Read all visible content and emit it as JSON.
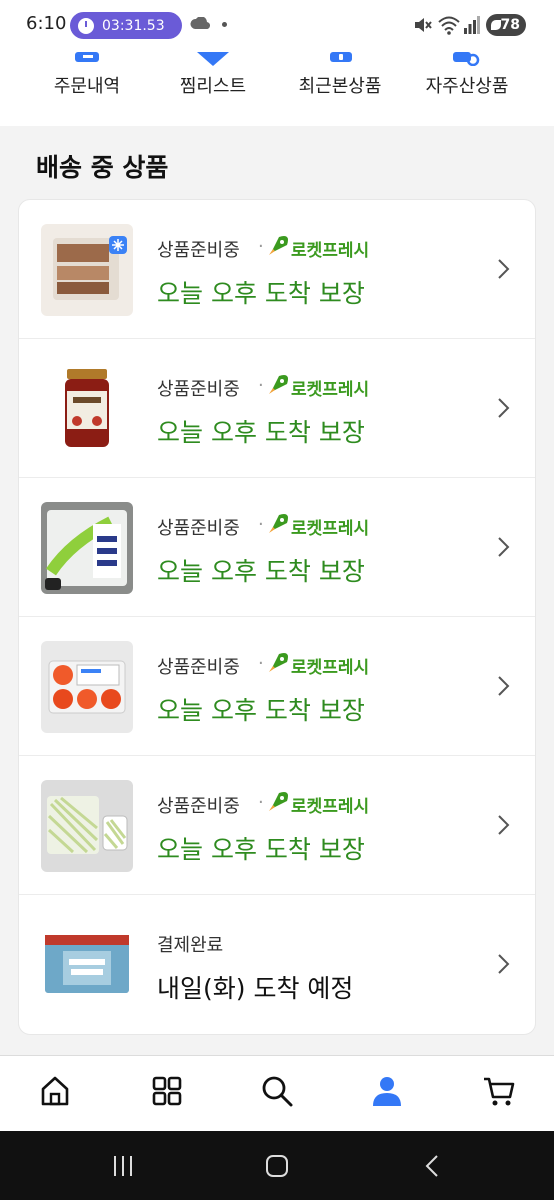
{
  "status_bar": {
    "time": "6:10",
    "timer": "03:31.53",
    "battery": "78"
  },
  "quick_menu": [
    {
      "label": "주문내역",
      "icon": "receipt-icon"
    },
    {
      "label": "찜리스트",
      "icon": "heart-icon"
    },
    {
      "label": "최근본상품",
      "icon": "recent-icon"
    },
    {
      "label": "자주산상품",
      "icon": "repeat-icon"
    }
  ],
  "section": {
    "title": "배송 중 상품"
  },
  "items": [
    {
      "status": "상품준비중",
      "badge": "로켓프레시",
      "eta": "오늘 오후 도착 보장"
    },
    {
      "status": "상품준비중",
      "badge": "로켓프레시",
      "eta": "오늘 오후 도착 보장"
    },
    {
      "status": "상품준비중",
      "badge": "로켓프레시",
      "eta": "오늘 오후 도착 보장"
    },
    {
      "status": "상품준비중",
      "badge": "로켓프레시",
      "eta": "오늘 오후 도착 보장"
    },
    {
      "status": "상품준비중",
      "badge": "로켓프레시",
      "eta": "오늘 오후 도착 보장"
    },
    {
      "status": "결제완료",
      "badge": "",
      "eta": "내일(화) 도착 예정"
    }
  ],
  "bottom_nav": [
    {
      "icon": "home-icon"
    },
    {
      "icon": "category-grid-icon"
    },
    {
      "icon": "search-icon"
    },
    {
      "icon": "my-page-icon"
    },
    {
      "icon": "cart-icon"
    }
  ],
  "colors": {
    "accent_green": "#2e8b1f",
    "nav_active": "#3478f6",
    "timer_pill": "#6a5bd7"
  }
}
